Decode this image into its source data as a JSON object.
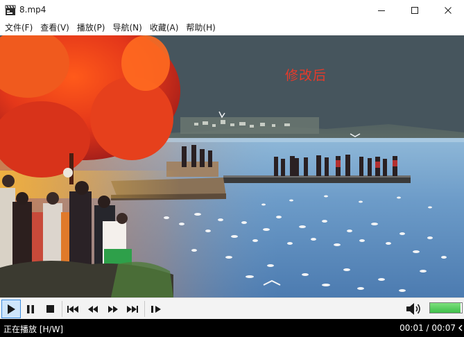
{
  "window": {
    "title": "8.mp4"
  },
  "menu": [
    {
      "label": "文件(F)"
    },
    {
      "label": "查看(V)"
    },
    {
      "label": "播放(P)"
    },
    {
      "label": "导航(N)"
    },
    {
      "label": "收藏(A)"
    },
    {
      "label": "帮助(H)"
    }
  ],
  "video": {
    "watermark": "修改后"
  },
  "controls": {
    "active_button": "play",
    "volume_level": 0.95,
    "volume_color": "#3fbf4a"
  },
  "status": {
    "state": "正在播放 [H/W]",
    "time": "00:01 / 00:07"
  },
  "colors": {
    "active_button_bg": "#cfe6fb",
    "active_button_border": "#3c8de0",
    "status_bg": "#000000"
  }
}
